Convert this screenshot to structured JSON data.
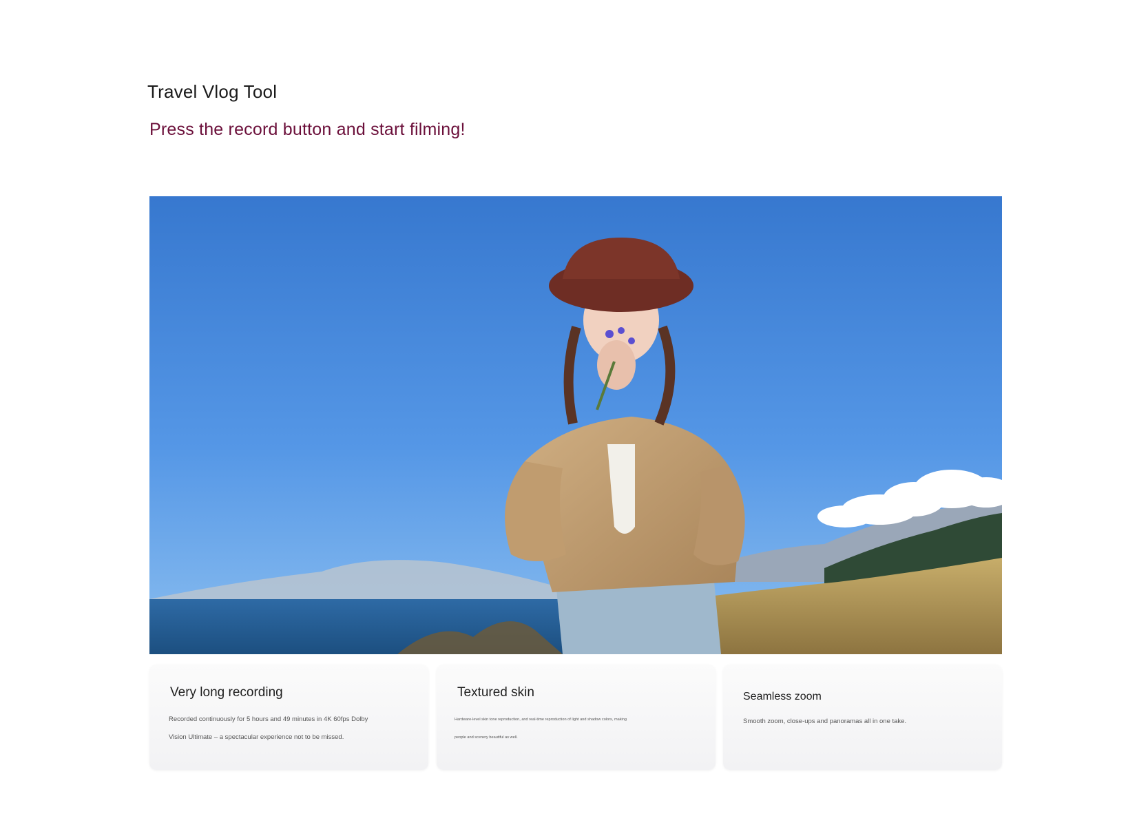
{
  "page": {
    "title": "Travel Vlog Tool",
    "subtitle": "Press the record button and start filming!"
  },
  "colors": {
    "subtitle": "#6b0f3a",
    "title": "#1a1a1a",
    "card_bg": "#f4f4f6"
  },
  "hero": {
    "icon": "travel-photo"
  },
  "features": [
    {
      "title": "Very long recording",
      "description": "Recorded continuously for 5 hours and 49 minutes in 4K 60fps Dolby Vision Ultimate – a spectacular experience not to be missed."
    },
    {
      "title": "Textured skin",
      "description": "Hardware-level skin tone reproduction, and real-time reproduction of light and shadow colors, making people and scenery beautiful as well."
    },
    {
      "title": "Seamless zoom",
      "description": "Smooth zoom, close-ups and panoramas all in one take."
    }
  ]
}
